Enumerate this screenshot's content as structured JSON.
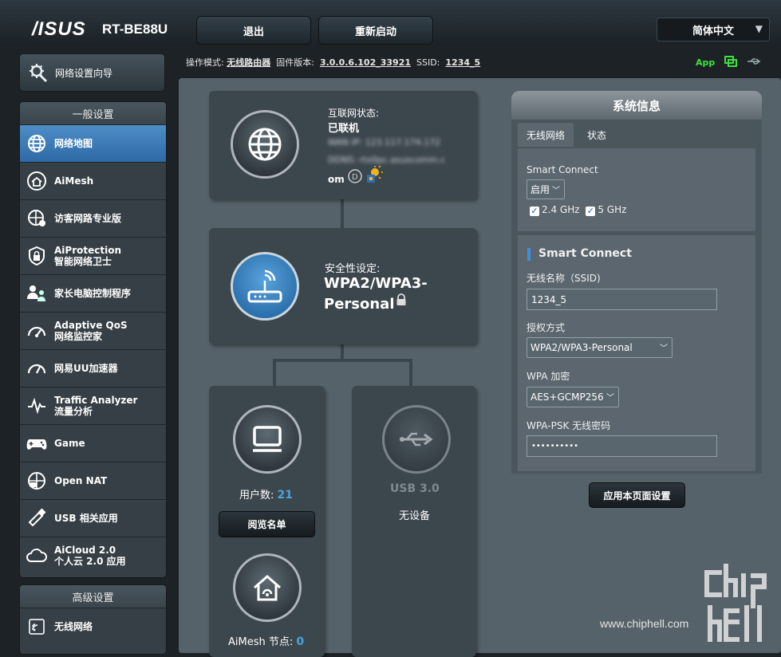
{
  "header": {
    "brand": "/ISUS",
    "model": "RT-BE88U",
    "logout_label": "退出",
    "reboot_label": "重新启动",
    "language": "简体中文"
  },
  "status": {
    "mode_label": "操作模式:",
    "mode_value": "无线路由器",
    "firmware_label": "固件版本:",
    "firmware_value": "3.0.0.6.102_33921",
    "ssid_label": "SSID:",
    "ssid_value": "1234_5",
    "app_label": "App"
  },
  "sidebar": {
    "wizard": "网络设置向导",
    "general_title": "一般设置",
    "general_items": [
      {
        "label": "网络地图",
        "sub": "",
        "icon": "network-map-icon"
      },
      {
        "label": "AiMesh",
        "sub": "",
        "icon": "aimesh-icon"
      },
      {
        "label": "访客网路专业版",
        "sub": "",
        "icon": "guest-network-icon"
      },
      {
        "label": "AiProtection",
        "sub": "智能网络卫士",
        "icon": "aiprotection-icon"
      },
      {
        "label": "家长电脑控制程序",
        "sub": "",
        "icon": "parental-control-icon"
      },
      {
        "label": "Adaptive QoS",
        "sub": "网络监控家",
        "icon": "qos-icon"
      },
      {
        "label": "网易UU加速器",
        "sub": "",
        "icon": "uu-accelerator-icon"
      },
      {
        "label": "Traffic Analyzer",
        "sub": "流量分析",
        "icon": "traffic-analyzer-icon"
      },
      {
        "label": "Game",
        "sub": "",
        "icon": "game-icon"
      },
      {
        "label": "Open NAT",
        "sub": "",
        "icon": "open-nat-icon"
      },
      {
        "label": "USB 相关应用",
        "sub": "",
        "icon": "usb-app-icon"
      },
      {
        "label": "AiCloud 2.0",
        "sub": "个人云 2.0 应用",
        "icon": "aicloud-icon"
      }
    ],
    "advanced_title": "高级设置",
    "advanced_items": [
      {
        "label": "无线网络",
        "icon": "wireless-icon"
      }
    ]
  },
  "map": {
    "internet_status_label": "互联网状态:",
    "internet_status_value": "已联机",
    "wan_ip_blurred": "WAN IP: 123.117.174.172",
    "ddns_blurred": "DDNS: rtx0pc.asuscomm.c",
    "ddns_tail": "om",
    "security_label": "安全性设定:",
    "security_value_line1": "WPA2/WPA3-",
    "security_value_line2": "Personal",
    "clients_label": "用户数:",
    "clients_count": "21",
    "view_list_label": "阅览名单",
    "usb_label": "USB 3.0",
    "usb_status": "无设备",
    "aimesh_nodes_label": "AiMesh 节点:",
    "aimesh_nodes_count": "0"
  },
  "sysinfo": {
    "title": "系统信息",
    "tab_wireless": "无线网络",
    "tab_status": "状态",
    "smart_connect_label": "Smart Connect",
    "smart_connect_value": "启用",
    "band1": "2.4 GHz",
    "band2": "5 GHz",
    "section_title": "Smart Connect",
    "ssid_label": "无线名称（SSID)",
    "ssid_value": "1234_5",
    "auth_label": "授权方式",
    "auth_value": "WPA2/WPA3-Personal",
    "enc_label": "WPA 加密",
    "enc_value": "AES+GCMP256",
    "psk_label": "WPA-PSK 无线密码",
    "psk_value": "••••••••••",
    "apply_label": "应用本页面设置"
  },
  "watermark": {
    "site": "www.chiphell.com",
    "logo": "chip hell"
  }
}
